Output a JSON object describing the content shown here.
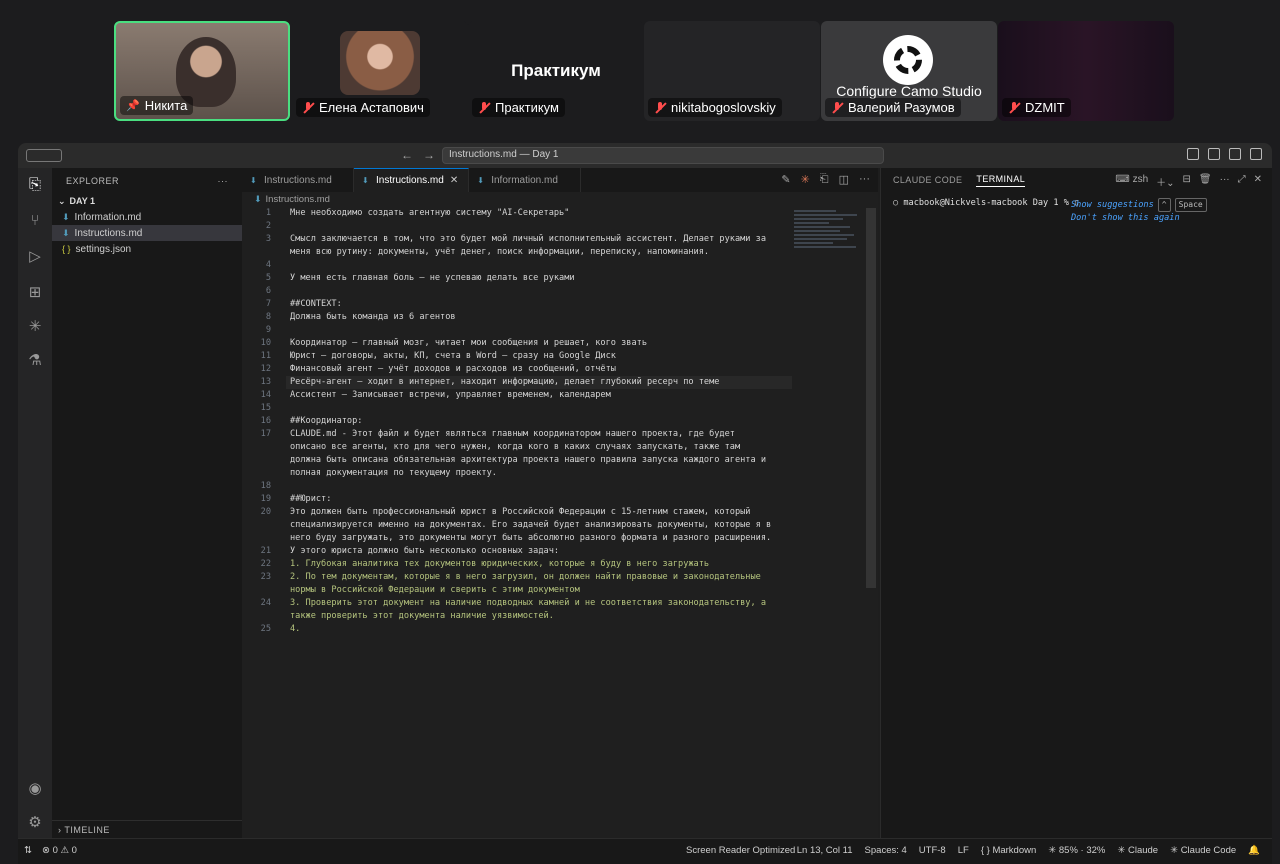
{
  "call": {
    "participants": [
      {
        "name": "Никита",
        "pinned": true
      },
      {
        "name": "Елена Астапович",
        "muted": true
      },
      {
        "name": "Практикум",
        "muted": true,
        "title": "Практикум"
      },
      {
        "name": "nikitabogoslovskiy",
        "muted": true
      },
      {
        "name": "Валерий Разумов",
        "muted": true,
        "overlay": "Configure Camo Studio"
      },
      {
        "name": "DZMIT",
        "muted": true
      }
    ]
  },
  "window": {
    "title": "Instructions.md — Day 1"
  },
  "sidebar": {
    "header": "EXPLORER",
    "more": "···",
    "folder": "DAY 1",
    "files": [
      {
        "name": "Information.md",
        "icon": "markdown-icon"
      },
      {
        "name": "Instructions.md",
        "icon": "markdown-icon",
        "active": true
      },
      {
        "name": "settings.json",
        "icon": "json-icon"
      }
    ],
    "timeline": "TIMELINE"
  },
  "editor": {
    "tabs": [
      {
        "label": "Instructions.md"
      },
      {
        "label": "Instructions.md",
        "active": true
      },
      {
        "label": "Information.md"
      }
    ],
    "close": "✕",
    "breadcrumb": "Instructions.md",
    "lines": [
      {
        "n": "1",
        "text": "Мне необходимо создать агентную систему \"AI-Секретарь\""
      },
      {
        "n": "2",
        "text": ""
      },
      {
        "n": "3",
        "text": "Смысл заключается в том, что это будет мой личный исполнительный ассистент. Делает руками за"
      },
      {
        "n": "",
        "text": "меня всю рутину: документы, учёт денег, поиск информации, переписку, напоминания."
      },
      {
        "n": "4",
        "text": ""
      },
      {
        "n": "5",
        "text": "У меня есть главная боль — не успеваю делать все руками"
      },
      {
        "n": "6",
        "text": ""
      },
      {
        "n": "7",
        "text": "##CONTEXT:"
      },
      {
        "n": "8",
        "text": "Должна быть команда из 6 агентов"
      },
      {
        "n": "9",
        "text": ""
      },
      {
        "n": "10",
        "text": "Координатор — главный мозг, читает мои сообщения и решает, кого звать"
      },
      {
        "n": "11",
        "text": "Юрист — договоры, акты, КП, счета в Word — сразу на Google Диск"
      },
      {
        "n": "12",
        "text": "Финансовый агент — учёт доходов и расходов из сообщений, отчёты"
      },
      {
        "n": "13",
        "text": "Ресёрч-агент — ходит в интернет, находит информацию, делает глубокий ресерч по теме"
      },
      {
        "n": "14",
        "text": "Ассистент — Записывает встречи, управляет временем, календарем"
      },
      {
        "n": "15",
        "text": ""
      },
      {
        "n": "16",
        "text": "##Координатор:"
      },
      {
        "n": "17",
        "text": "CLAUDE.md - Этот файл и будет являться главным координатором нашего проекта, где будет"
      },
      {
        "n": "",
        "text": "описано все агенты, кто для чего нужен, когда кого в каких случаях запускать, также там"
      },
      {
        "n": "",
        "text": "должна быть описана обязательная архитектура проекта нашего правила запуска каждого агента и"
      },
      {
        "n": "",
        "text": "полная документация по текущему проекту."
      },
      {
        "n": "18",
        "text": ""
      },
      {
        "n": "19",
        "text": "##Юрист:"
      },
      {
        "n": "20",
        "text": "Это должен быть профессиональный юрист в Российской Федерации с 15-летним стажем, который"
      },
      {
        "n": "",
        "text": "специализируется именно на документах. Его задачей будет анализировать документы, которые я в"
      },
      {
        "n": "",
        "text": "него буду загружать, это документы могут быть абсолютно разного формата и разного расширения."
      },
      {
        "n": "21",
        "text": "У этого юриста должно быть несколько основных задач:"
      },
      {
        "n": "22",
        "text": "1. Глубокая аналитика тех документов юридических, которые я буду в него загружать",
        "green": true
      },
      {
        "n": "23",
        "text": "2. По тем документам, которые я в него загрузил, он должен найти правовые и законодательные",
        "green": true
      },
      {
        "n": "",
        "text": "нормы в Российской Федерации и сверить с этим документом",
        "green": true
      },
      {
        "n": "24",
        "text": "3. Проверить этот документ на наличие подводных камней и не соответствия законодательству, а",
        "green": true
      },
      {
        "n": "",
        "text": "также проверить этот документа наличие уязвимостей.",
        "green": true
      },
      {
        "n": "25",
        "text": "4.",
        "green": true
      }
    ]
  },
  "panel": {
    "tabs": [
      "CLAUDE CODE",
      "TERMINAL"
    ],
    "shell": "zsh",
    "prompt": "macbook@Nickvels-macbook Day 1 %",
    "suggestions": [
      "Show suggestions",
      "Don't show this again"
    ],
    "key_hint": "^",
    "key_space": "Space"
  },
  "status": {
    "errors": "⊗ 0 ⚠ 0",
    "screen_reader": "Screen Reader Optimized",
    "position": "Ln 13, Col 11",
    "spaces": "Spaces: 4",
    "encoding": "UTF-8",
    "eol": "LF",
    "language": "Markdown",
    "zoom": "85% · 32%",
    "claude": "Claude",
    "claude_code": "Claude Code"
  },
  "colors": {
    "accent": "#0078d4",
    "call_active_border": "#4ade80",
    "muted_mic": "#ff4d4d",
    "list_text": "#b5c47e"
  }
}
